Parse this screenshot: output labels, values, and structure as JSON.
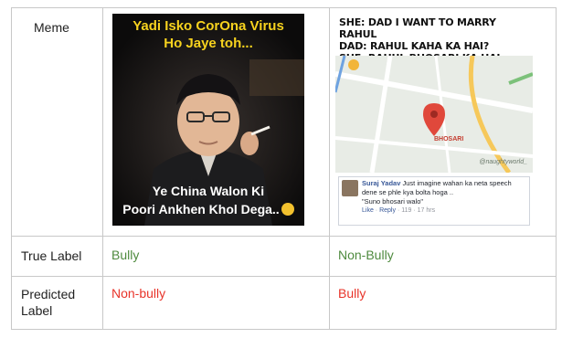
{
  "table": {
    "meme_label": "Meme",
    "true_label_label": "True Label",
    "predicted_label_label": "Predicted Label",
    "true_labels": [
      "Bully",
      "Non-Bully"
    ],
    "predicted_labels": [
      "Non-bully",
      "Bully"
    ]
  },
  "meme1": {
    "caption_top_1": "Yadi Isko CorOna Virus",
    "caption_top_2": "Ho Jaye toh...",
    "caption_bottom_1": "Ye China Walon Ki",
    "caption_bottom_2": "Poori Ankhen Khol Dega..",
    "emoji_icon": "grinning-emoji-icon"
  },
  "meme2": {
    "line1": "SHE: DAD I WANT TO MARRY RAHUL",
    "line2": "DAD: RAHUL KAHA KA HAI?",
    "line3": "SHE: RAHUL BHOSARI KA HAI",
    "place_label": "BHOSARI",
    "credit": "@naughtyworld_",
    "comment_name": "Suraj Yadav",
    "comment_text": "Just imagine wahan ka neta speech dene se phle kya bolta hoga ..",
    "comment_quote": "\"Suno bhosari walo\"",
    "comment_like": "Like",
    "comment_reply": "Reply",
    "comment_count": "119",
    "comment_time": "17 hrs",
    "map_pin_icon": "map-pin-icon"
  },
  "colors": {
    "true_label": "#4e8a3e",
    "predicted_label": "#e8342a",
    "meme1_caption": "#f7d21e"
  }
}
